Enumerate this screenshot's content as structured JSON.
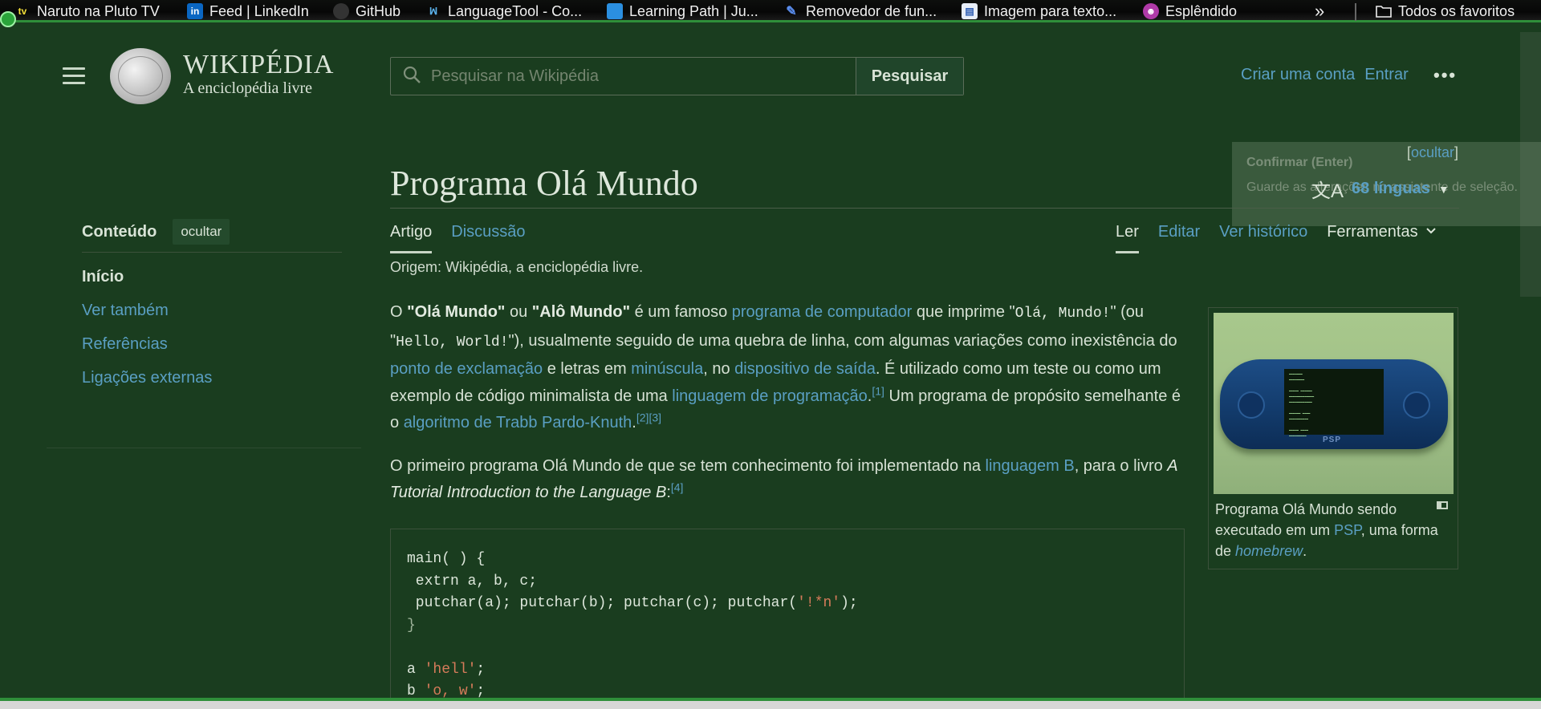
{
  "bookmarks": [
    {
      "label": "Naruto na Pluto TV",
      "icon": "pluto-tv-icon"
    },
    {
      "label": "Feed | LinkedIn",
      "icon": "linkedin-icon"
    },
    {
      "label": "GitHub",
      "icon": "github-icon"
    },
    {
      "label": "LanguageTool - Co...",
      "icon": "languagetool-icon"
    },
    {
      "label": "Learning Path | Ju...",
      "icon": "learning-path-icon"
    },
    {
      "label": "Removedor de fun...",
      "icon": "remover-icon"
    },
    {
      "label": "Imagem para texto...",
      "icon": "image-to-text-icon"
    },
    {
      "label": "Esplêndido",
      "icon": "esplendido-icon"
    }
  ],
  "bookmarks_more": "»",
  "favorites_label": "Todos os favoritos",
  "header": {
    "wordmark_title": "WIKIPÉDIA",
    "wordmark_tagline": "A enciclopédia livre",
    "search_placeholder": "Pesquisar na Wikipédia",
    "search_button": "Pesquisar",
    "create_account": "Criar uma conta",
    "login": "Entrar",
    "more": "•••"
  },
  "tooltip": {
    "hide_label": "ocultar",
    "title": "Confirmar (Enter)",
    "body": "Guarde as alterações no assistente de seleção."
  },
  "languages": {
    "label": "68 línguas"
  },
  "article": {
    "title": "Programa Olá Mundo",
    "tab_article": "Artigo",
    "tab_discussion": "Discussão",
    "tab_read": "Ler",
    "tab_edit": "Editar",
    "tab_history": "Ver histórico",
    "tab_tools": "Ferramentas",
    "origin": "Origem: Wikipédia, a enciclopédia livre."
  },
  "toc": {
    "title": "Conteúdo",
    "hide": "ocultar",
    "items": [
      "Início",
      "Ver também",
      "Referências",
      "Ligações externas"
    ]
  },
  "paragraph1": {
    "t1": "O ",
    "b1": "\"Olá Mundo\"",
    "t2": " ou ",
    "b2": "\"Alô Mundo\"",
    "t3": " é um famoso ",
    "l1": "programa de computador",
    "t4": " que imprime \"",
    "c1": "Olá, Mundo!",
    "t5": "\" (ou \"",
    "c2": "Hello, World!",
    "t6": "\"), usualmente seguido de uma quebra de linha, com algumas variações como inexistência do ",
    "l2": "ponto de exclamação",
    "t7": " e letras em ",
    "l3": "minúscula",
    "t8": ", no ",
    "l4": "dispositivo de saída",
    "t9": ". É utilizado como um teste ou como um exemplo de código minimalista de uma ",
    "l5": "linguagem de programação",
    "t10": ".",
    "r1": "[1]",
    "t11": " Um programa de propósito semelhante é o ",
    "l6": "algoritmo de Trabb Pardo-Knuth",
    "t12": ".",
    "r2": "[2]",
    "r3": "[3]"
  },
  "paragraph2": {
    "t1": "O primeiro programa Olá Mundo de que se tem conhecimento foi implementado na ",
    "l1": "linguagem B",
    "t2": ", para o livro ",
    "i1": "A Tutorial Introduction to the Language B",
    "t3": ":",
    "r1": "[4]"
  },
  "figure": {
    "caption_t1": "Programa Olá Mundo sendo executado em um ",
    "caption_link": "PSP",
    "caption_t2": ", uma forma de ",
    "caption_italic": "homebrew",
    "caption_t3": ".",
    "psp_logo": "PSP"
  },
  "code": {
    "line1": "main( ) {",
    "line2": " extrn a, b, c;",
    "line3a": " putchar(a); putchar(b); putchar(c); putchar(",
    "line3s": "'!*n'",
    "line3b": ");",
    "line4": "}",
    "line6a": "a ",
    "line6s": "'hell'",
    "line6b": ";",
    "line7a": "b ",
    "line7s": "'o, w'",
    "line7b": ";"
  },
  "colors": {
    "background": "#1a3d1f",
    "link": "#5a9fc3",
    "accent_green": "#2f8f3a"
  }
}
